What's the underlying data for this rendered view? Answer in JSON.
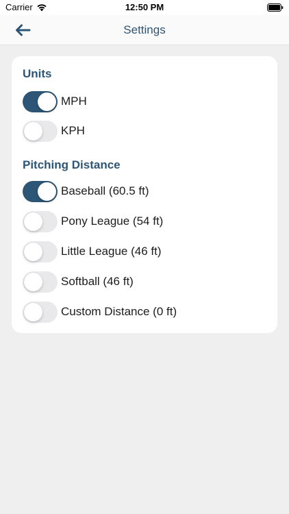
{
  "status_bar": {
    "carrier": "Carrier",
    "time": "12:50 PM"
  },
  "nav": {
    "title": "Settings",
    "back_icon": "arrow-left-icon"
  },
  "colors": {
    "accent": "#2d5575",
    "toggle_off": "#e9e9eb",
    "background": "#efefef"
  },
  "units": {
    "title": "Units",
    "options": [
      {
        "label": "MPH",
        "on": true
      },
      {
        "label": "KPH",
        "on": false
      }
    ]
  },
  "pitching": {
    "title": "Pitching Distance",
    "options": [
      {
        "label": "Baseball (60.5 ft)",
        "on": true
      },
      {
        "label": "Pony League (54 ft)",
        "on": false
      },
      {
        "label": "Little League (46 ft)",
        "on": false
      },
      {
        "label": "Softball (46 ft)",
        "on": false
      },
      {
        "label": "Custom Distance (0 ft)",
        "on": false
      }
    ]
  }
}
